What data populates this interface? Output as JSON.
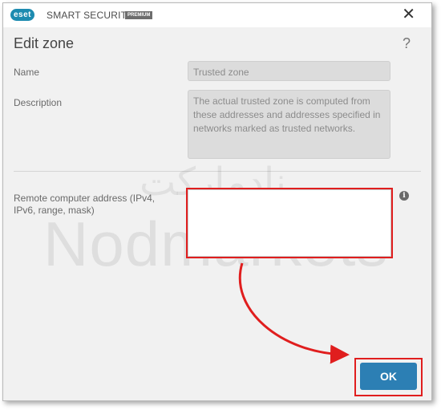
{
  "titlebar": {
    "logo_text": "eset",
    "product_name": "SMART SECURITY",
    "edition_badge": "PREMIUM",
    "close_glyph": "✕"
  },
  "dialog": {
    "heading": "Edit zone",
    "help_glyph": "?"
  },
  "form": {
    "name_label": "Name",
    "name_value": "Trusted zone",
    "description_label": "Description",
    "description_value": "The actual trusted zone is computed from these addresses and addresses specified in networks marked as trusted networks.",
    "remote_label": "Remote computer address (IPv4, IPv6, range, mask)",
    "remote_value": "",
    "info_glyph": "i"
  },
  "watermark": {
    "arabic": "نادمارکت",
    "latin": "Nodmarkets"
  },
  "buttons": {
    "ok_label": "OK"
  },
  "colors": {
    "accent": "#2c7fb4",
    "highlight": "#e01e1e",
    "logo": "#1d8bb0"
  }
}
